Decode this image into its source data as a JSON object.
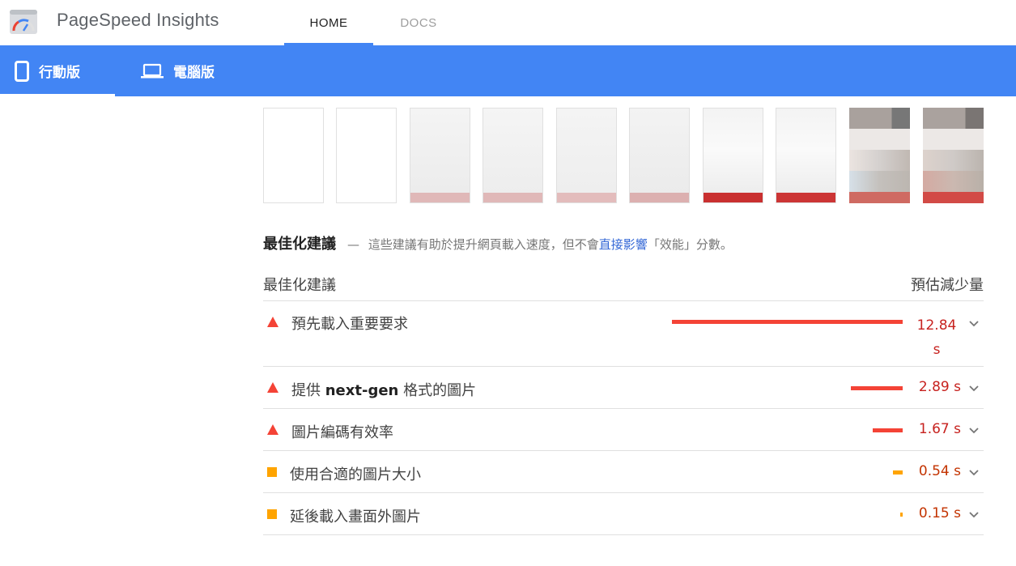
{
  "header": {
    "app_title": "PageSpeed Insights",
    "tabs": [
      {
        "label": "HOME",
        "active": true
      },
      {
        "label": "DOCS",
        "active": false
      }
    ]
  },
  "device_tabs": [
    {
      "label": "行動版",
      "icon": "smartphone-icon",
      "active": true
    },
    {
      "label": "電腦版",
      "icon": "laptop-icon",
      "active": false
    }
  ],
  "colors": {
    "brand_blue": "#4285f4",
    "fail_red": "#f44336",
    "average_orange": "#ffa400",
    "fail_text": "#c7221f",
    "average_text": "#c33300"
  },
  "filmstrip_count": 10,
  "opportunities": {
    "title": "最佳化建議",
    "dash": "—",
    "desc_before": "這些建議有助於提升網頁載入速度，但不會",
    "desc_link": "直接影響",
    "desc_after": "「效能」分數。",
    "col_left": "最佳化建議",
    "col_right": "預估減少量",
    "rows": [
      {
        "label_pre": "預先載入重要要求",
        "label_bold": "",
        "label_post": "",
        "value": "12.84 s",
        "severity": "fail",
        "bar_fraction": 1.0
      },
      {
        "label_pre": "提供 ",
        "label_bold": "next-gen",
        "label_post": " 格式的圖片",
        "value": "2.89 s",
        "severity": "fail",
        "bar_fraction": 0.225
      },
      {
        "label_pre": "圖片編碼有效率",
        "label_bold": "",
        "label_post": "",
        "value": "1.67 s",
        "severity": "fail",
        "bar_fraction": 0.13
      },
      {
        "label_pre": "使用合適的圖片大小",
        "label_bold": "",
        "label_post": "",
        "value": "0.54 s",
        "severity": "average",
        "bar_fraction": 0.042
      },
      {
        "label_pre": "延後載入畫面外圖片",
        "label_bold": "",
        "label_post": "",
        "value": "0.15 s",
        "severity": "average",
        "bar_fraction": 0.012
      }
    ]
  }
}
